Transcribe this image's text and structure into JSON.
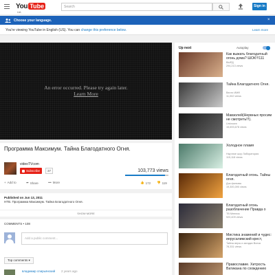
{
  "header": {
    "logo_you": "You",
    "logo_tube": "Tube",
    "country": "UA",
    "search_placeholder": "Search",
    "signin_label": "Sign in"
  },
  "language_banner": {
    "title": "Choose your language.",
    "message_prefix": "You're viewing YouTube in English (US). You can ",
    "message_link": "change this preference below.",
    "learn_more": "Learn more",
    "close": "×"
  },
  "player": {
    "error_line1": "An error occurred. Please try again later.",
    "error_line2": "Learn More"
  },
  "video": {
    "title": "Программа Максимум. Тайна Благодатного Огня.",
    "channel": "videoTVcom",
    "subscribe_label": "Subscribe",
    "subscriber_count": "37",
    "views": "103,773 views",
    "like_ratio": 0.92,
    "add_to": "Add to",
    "share": "Share",
    "more": "More",
    "likes": "172",
    "dislikes": "119",
    "published": "Published on Jun 13, 2011",
    "description": "НТВ. Программа Максимум. Тайна Благодатного Огня.",
    "show_more": "SHOW MORE"
  },
  "comments": {
    "header": "COMMENTS • 108",
    "placeholder": "Add a public comment...",
    "sort_label": "Top comments",
    "first_user": "владимир спирьянский",
    "first_time": "2 years ago"
  },
  "sidebar": {
    "up_next": "Up next",
    "autoplay": "Autoplay",
    "autoplay_on": true,
    "videos": [
      {
        "title": "Как выжать благодатный огонь дома? ШОК!!!111",
        "channel": "ВЫРД",
        "views": "294,213 views",
        "duration": "",
        "color1": "#6b3b2a",
        "color2": "#d9b08c"
      },
      {
        "title": "Тайна Благодатного Огня.",
        "channel": "Вести ИМФ",
        "views": "11,002 views",
        "duration": "",
        "color1": "#3a3a3a",
        "color2": "#c9c9c9"
      },
      {
        "title": "Мавзолей(Нервных просим не смотреть!!!).",
        "channel": "Unknown",
        "views": "15,693,678 views",
        "duration": "",
        "color1": "#1a1a1a",
        "color2": "#6a6a6a"
      },
      {
        "title": "Холодное пламя",
        "channel": "Научное шоу Лаборатория",
        "views": "115,118 views",
        "duration": "",
        "color1": "#4c7a6a",
        "color2": "#d8efe3"
      },
      {
        "title": "Благодатный огонь. Тайны огня.",
        "channel": "Док фильмы",
        "views": "19,300,390 views",
        "duration": "",
        "color1": "#5a2a08",
        "color2": "#f1a340"
      },
      {
        "title": "Благодатный огонь разоблачение Правда о чуде",
        "channel": "ТВ Мнения",
        "views": "920,409 views",
        "duration": "",
        "color1": "#2b2b3a",
        "color2": "#8a7f6d"
      },
      {
        "title": "Мистика знамений и чудес: иерусалимский крест, благодатный",
        "channel": "Тайны веры и загадки Всеза",
        "views": "78,331 views",
        "duration": "",
        "color1": "#3b2410",
        "color2": "#d3a36a"
      },
      {
        "title": "Православие. Хитрость Ватикана по схождению",
        "channel": "",
        "views": "",
        "duration": "",
        "color1": "#5a3a28",
        "color2": "#c9a27a"
      }
    ]
  }
}
